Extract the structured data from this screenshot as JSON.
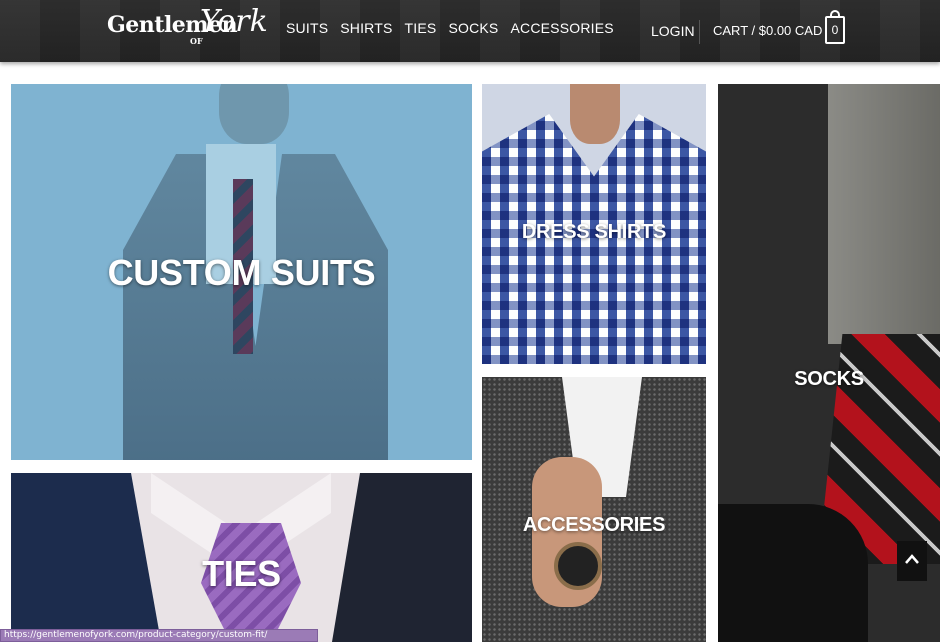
{
  "header": {
    "logo": {
      "main": "Gentlemen",
      "of": "OF",
      "script": "York"
    },
    "nav": [
      "SUITS",
      "SHIRTS",
      "TIES",
      "SOCKS",
      "ACCESSORIES"
    ],
    "login": "LOGIN",
    "cart": {
      "label": "CART / $0.00 CAD",
      "count": "0"
    }
  },
  "tiles": {
    "custom_suits": "CUSTOM SUITS",
    "dress_shirts": "DRESS SHIRTS",
    "socks": "SOCKS",
    "accessories": "ACCESSORIES",
    "ties": "TIES"
  },
  "status_bar": {
    "url": "https://gentlemenofyork.com/product-category/custom-fit/"
  },
  "colors": {
    "header_bg": "#2b2b2b",
    "suits_overlay": "#7fb3d1",
    "status_bar": "#9b7bb6"
  },
  "icons": {
    "back_to_top": "chevron-up-icon",
    "cart": "shopping-bag-icon"
  }
}
